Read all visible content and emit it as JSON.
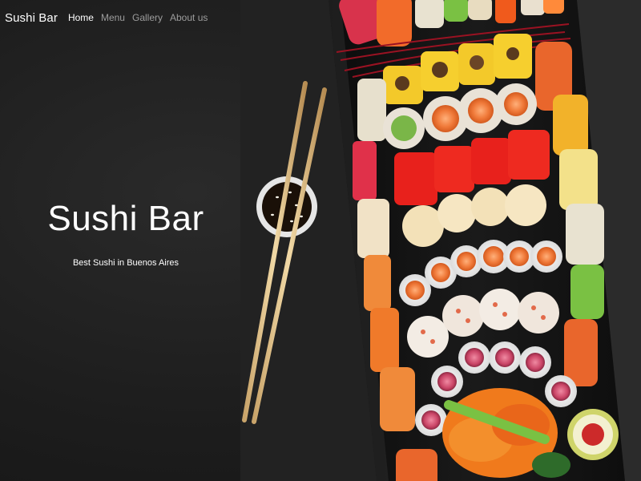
{
  "navbar": {
    "brand": "Sushi Bar",
    "links": [
      {
        "label": "Home",
        "active": true
      },
      {
        "label": "Menu",
        "active": false
      },
      {
        "label": "Gallery",
        "active": false
      },
      {
        "label": "About us",
        "active": false
      }
    ]
  },
  "hero": {
    "title": "Sushi Bar",
    "subtitle": "Best Sushi in Buenos Aires"
  },
  "image": {
    "icon": "sushi-platter-image"
  },
  "colors": {
    "background": "#1c1c1c",
    "text": "#ffffff",
    "nav_inactive": "#8c8c8c"
  }
}
